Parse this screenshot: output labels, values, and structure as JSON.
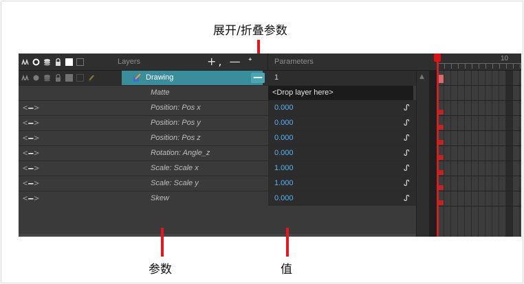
{
  "annotations": {
    "top": "展开/折叠参数",
    "param": "参数",
    "value": "值"
  },
  "header": {
    "layers_label": "Layers",
    "parameters_label": "Parameters",
    "tools": "+, — ᐩ"
  },
  "layer": {
    "name": "Drawing",
    "collapse_symbol": "—",
    "value": "1"
  },
  "params": [
    {
      "name": "Matte",
      "value": "<Drop layer here>",
      "type": "drop"
    },
    {
      "name": "Position: Pos x",
      "value": "0.000"
    },
    {
      "name": "Position: Pos y",
      "value": "0.000"
    },
    {
      "name": "Position: Pos z",
      "value": "0.000"
    },
    {
      "name": "Rotation: Angle_z",
      "value": "0.000"
    },
    {
      "name": "Scale: Scale x",
      "value": "1.000"
    },
    {
      "name": "Scale: Scale y",
      "value": "1.000"
    },
    {
      "name": "Skew",
      "value": "0.000"
    }
  ],
  "timeline": {
    "frame_label": "10"
  },
  "colors": {
    "accent": "#e8161c",
    "layer_highlight": "#3a8d9b",
    "value_text": "#58b4f6"
  }
}
